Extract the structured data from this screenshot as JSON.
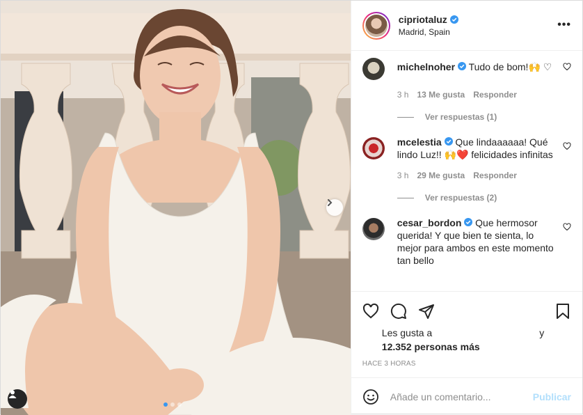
{
  "post": {
    "username": "cipriotaluz",
    "location": "Madrid, Spain",
    "more_label": "•••"
  },
  "comments": [
    {
      "user": "michelnoher",
      "text": "Tudo de bom!🙌 ♡",
      "time": "3 h",
      "likes": "13 Me gusta",
      "reply": "Responder",
      "replies": "Ver respuestas (1)"
    },
    {
      "user": "mcelestia",
      "text": "Que lindaaaaaa! Qué lindo Luz!! 🙌❤️ felicidades infinitas",
      "time": "3 h",
      "likes": "29 Me gusta",
      "reply": "Responder",
      "replies": "Ver respuestas (2)"
    },
    {
      "user": "cesar_bordon",
      "text": "Que hermosor querida! Y que bien te sienta, lo mejor para ambos en este momento tan bello"
    }
  ],
  "likes": {
    "prefix": "Les gusta a",
    "connector": "y",
    "count": "12.352 personas más"
  },
  "timestamp": "HACE 3 HORAS",
  "add_comment": {
    "placeholder": "Añade un comentario...",
    "publish": "Publicar"
  },
  "colors": {
    "verified": "#3897f0",
    "publish_disabled": "#b2dffc",
    "meta_text": "#8e8e8e"
  },
  "icons": [
    "verified-icon",
    "more-options-icon",
    "heart-icon",
    "comment-icon",
    "share-icon",
    "save-icon",
    "emoji-icon",
    "chevron-right-icon",
    "user-tag-icon"
  ]
}
